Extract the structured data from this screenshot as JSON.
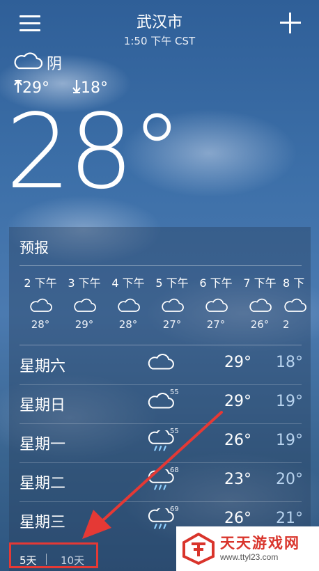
{
  "header": {
    "city": "武汉市",
    "time": "1:50 下午 CST"
  },
  "current": {
    "condition": "阴",
    "high": "29°",
    "low": "18°",
    "temperature": "28°",
    "condition_icon": "cloud-icon"
  },
  "forecast": {
    "title": "预报",
    "hourly": [
      {
        "time": "2 下午",
        "temp": "28°",
        "icon": "cloud-icon"
      },
      {
        "time": "3 下午",
        "temp": "29°",
        "icon": "cloud-icon"
      },
      {
        "time": "4 下午",
        "temp": "28°",
        "icon": "cloud-icon"
      },
      {
        "time": "5 下午",
        "temp": "27°",
        "icon": "cloud-icon"
      },
      {
        "time": "6 下午",
        "temp": "27°",
        "icon": "cloud-icon"
      },
      {
        "time": "7 下午",
        "temp": "26°",
        "icon": "cloud-icon"
      },
      {
        "time": "8 下",
        "temp": "2",
        "icon": "cloud-icon"
      }
    ],
    "daily": [
      {
        "day": "星期六",
        "icon": "cloud-icon",
        "precip": "",
        "high": "29°",
        "low": "18°"
      },
      {
        "day": "星期日",
        "icon": "cloud-icon",
        "precip": "55",
        "high": "29°",
        "low": "19°"
      },
      {
        "day": "星期一",
        "icon": "rain-icon",
        "precip": "55",
        "high": "26°",
        "low": "19°"
      },
      {
        "day": "星期二",
        "icon": "rain-icon",
        "precip": "68",
        "high": "23°",
        "low": "20°"
      },
      {
        "day": "星期三",
        "icon": "rain-icon",
        "precip": "69",
        "high": "26°",
        "low": "21°"
      }
    ],
    "tabs": {
      "five_day": "5天",
      "ten_day": "10天"
    }
  },
  "watermark": {
    "title": "天天游戏网",
    "url": "www.ttyl23.com"
  },
  "colors": {
    "highlight_box": "#e53935",
    "low_temp": "#b9d4ef"
  }
}
